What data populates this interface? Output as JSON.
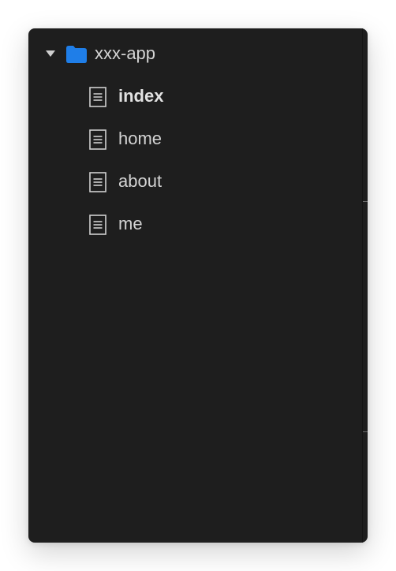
{
  "colors": {
    "panel_bg": "#1e1e1e",
    "text": "#d4d4d4",
    "folder_accent": "#1f7ee8",
    "icon_stroke": "#cfcfcf"
  },
  "explorer": {
    "root": {
      "label": "xxx-app",
      "icon": "folder-icon",
      "expanded": true
    },
    "files": [
      {
        "label": "index",
        "icon": "file-icon",
        "active": true
      },
      {
        "label": "home",
        "icon": "file-icon",
        "active": false
      },
      {
        "label": "about",
        "icon": "file-icon",
        "active": false
      },
      {
        "label": "me",
        "icon": "file-icon",
        "active": false
      }
    ]
  }
}
